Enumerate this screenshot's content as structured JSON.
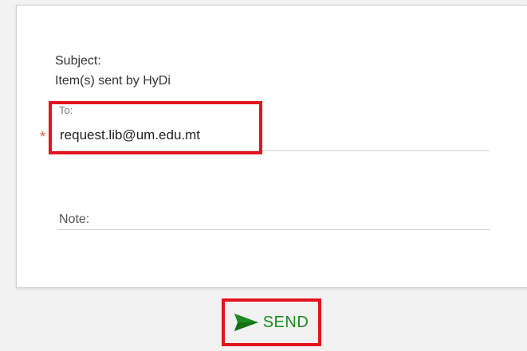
{
  "form": {
    "subject_label": "Subject:",
    "subject_value": "Item(s) sent by HyDi",
    "to_label": "To:",
    "to_value": "request.lib@um.edu.mt",
    "required_marker": "*",
    "note_label": "Note:"
  },
  "actions": {
    "send_label": "SEND",
    "send_icon": "paper-plane-icon"
  },
  "colors": {
    "accent_green": "#1f8a1f",
    "highlight_red": "#e3141e",
    "required_orange": "#e8603a"
  }
}
